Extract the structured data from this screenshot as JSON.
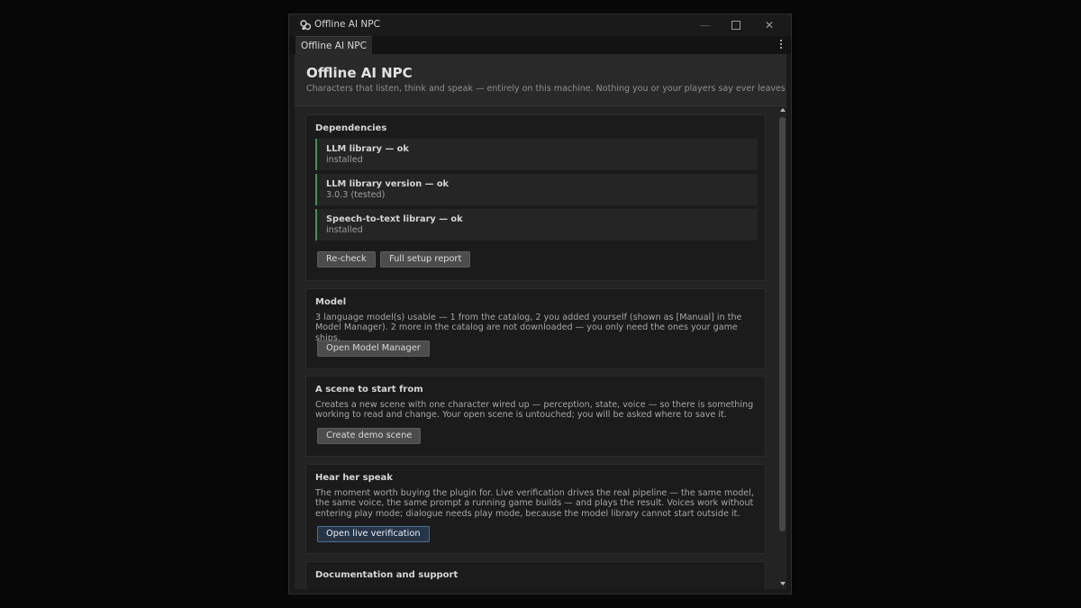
{
  "window": {
    "title": "Offline AI NPC",
    "icon": "gear-cluster-icon",
    "controls": {
      "minimize": "—",
      "maximize": "□",
      "close": "✕"
    }
  },
  "tab": {
    "label": "Offline AI NPC",
    "menu_icon": "kebab-menu-icon"
  },
  "header": {
    "title": "Offline AI NPC",
    "subtitle": "Characters that listen, think and speak — entirely on this machine. Nothing you or your players say ever leaves it."
  },
  "dependencies": {
    "title": "Dependencies",
    "items": [
      {
        "name": "LLM library — ok",
        "status": "installed"
      },
      {
        "name": "LLM library version — ok",
        "status": "3.0.3 (tested)"
      },
      {
        "name": "Speech-to-text library — ok",
        "status": "installed"
      }
    ],
    "recheck_label": "Re-check",
    "report_label": "Full setup report",
    "ok_color": "#4e8a5c"
  },
  "model": {
    "title": "Model",
    "body": "3 language model(s) usable — 1 from the catalog, 2 you added yourself (shown as [Manual] in the Model Manager). 2 more in the catalog are not downloaded — you only need the ones your game ships.",
    "button_label": "Open Model Manager"
  },
  "scene": {
    "title": "A scene to start from",
    "body": "Creates a new scene with one character wired up — perception, state, voice — so there is something working to read and change. Your open scene is untouched; you will be asked where to save it.",
    "button_label": "Create demo scene"
  },
  "speak": {
    "title": "Hear her speak",
    "body": "The moment worth buying the plugin for. Live verification drives the real pipeline — the same model, the same voice, the same prompt a running game builds — and plays the result. Voices work without entering play mode; dialogue needs play mode, because the model library cannot start outside it.",
    "button_label": "Open live verification"
  },
  "docs": {
    "title": "Documentation and support"
  }
}
